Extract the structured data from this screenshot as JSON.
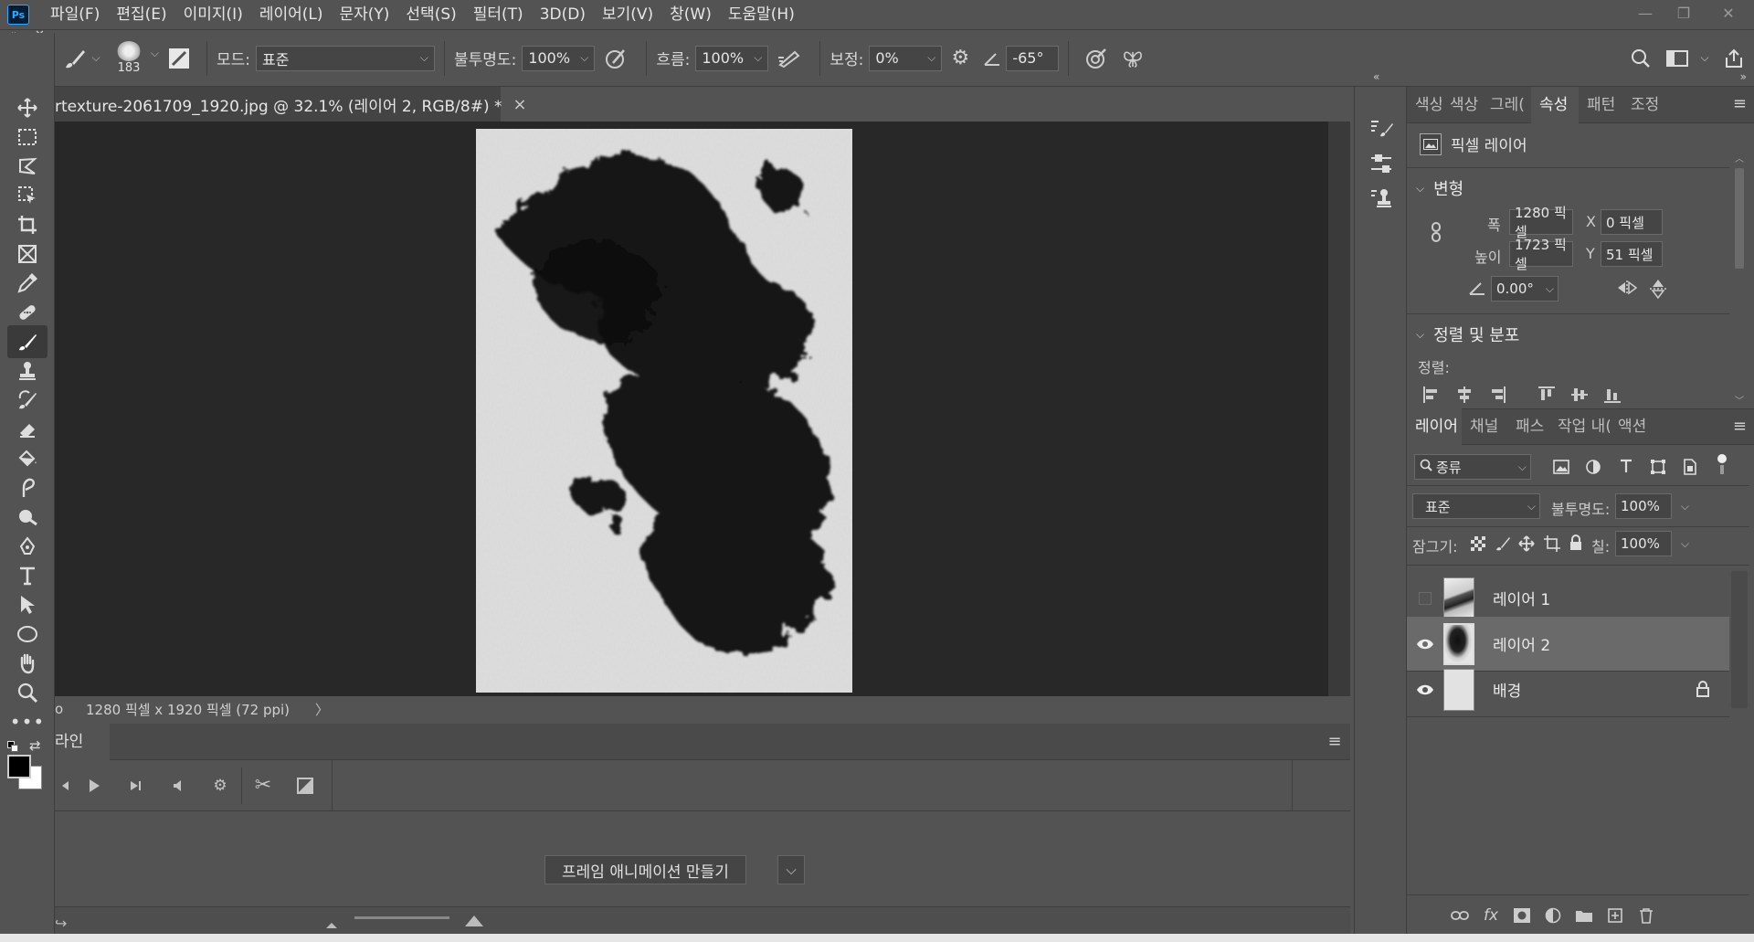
{
  "menu": {
    "logo": "Ps",
    "items": [
      "파일(F)",
      "편집(E)",
      "이미지(I)",
      "레이어(L)",
      "문자(Y)",
      "선택(S)",
      "필터(T)",
      "3D(D)",
      "보기(V)",
      "창(W)",
      "도움말(H)"
    ]
  },
  "options": {
    "brush_size": "183",
    "mode_label": "모드:",
    "mode_value": "표준",
    "opacity_label": "불투명도:",
    "opacity_value": "100%",
    "flow_label": "흐름:",
    "flow_value": "100%",
    "smoothing_label": "보정:",
    "smoothing_value": "0%",
    "angle_value": "-65°"
  },
  "document": {
    "tab_title": "rtexture-2061709_1920.jpg @ 32.1% (레이어 2, RGB/8#) *",
    "tab_close": "×",
    "status_zoom": "o",
    "status_text": "1280 픽셀 x 1920 픽셀 (72 ppi)",
    "status_arrow": "〉"
  },
  "timeline": {
    "tab_label": "라인",
    "create_button": "프레임 애니메이션 만들기"
  },
  "properties": {
    "tabs": [
      "색상",
      "색상",
      "그레(",
      "속성",
      "패턴",
      "조정"
    ],
    "active_tab": "속성",
    "layer_kind": "픽셀 레이어",
    "transform_title": "변형",
    "width_label": "폭",
    "width_value": "1280 픽셀",
    "height_label": "높이",
    "height_value": "1723 픽셀",
    "x_label": "X",
    "x_value": "0 픽셀",
    "y_label": "Y",
    "y_value": "51 픽셀",
    "angle_value": "0.00°",
    "align_title": "정렬 및 분포",
    "align_label": "정렬:"
  },
  "layers_panel": {
    "tabs": [
      "레이어",
      "채널",
      "패스",
      "작업 내(",
      "액션"
    ],
    "active_tab": "레이어",
    "filter_label": "종류",
    "blend_mode": "표준",
    "opacity_label": "불투명도:",
    "opacity_value": "100%",
    "lock_label": "잠그기:",
    "fill_label": "칠:",
    "fill_value": "100%",
    "layers": [
      {
        "name": "레이어 1",
        "visible": false,
        "selected": false
      },
      {
        "name": "레이어 2",
        "visible": true,
        "selected": true
      },
      {
        "name": "배경",
        "visible": true,
        "selected": false,
        "locked": true
      }
    ]
  },
  "colors": {
    "foreground": "#000000",
    "background": "#ffffff",
    "accent": "#31a8ff"
  }
}
